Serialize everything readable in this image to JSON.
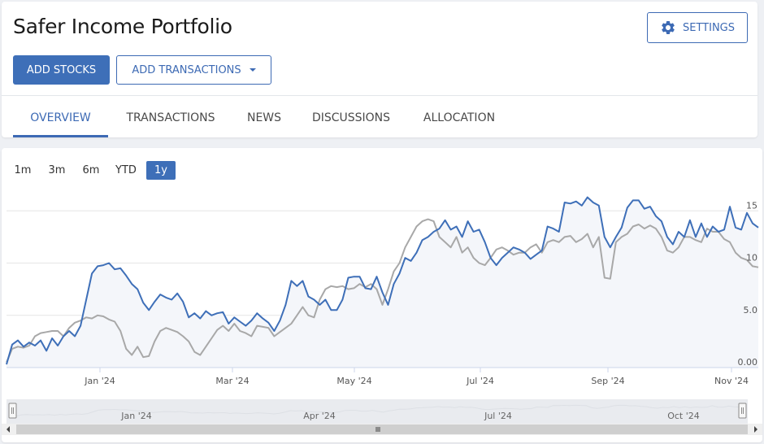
{
  "header": {
    "title": "Safer Income Portfolio",
    "settings_label": "SETTINGS",
    "add_stocks_label": "ADD STOCKS",
    "add_transactions_label": "ADD TRANSACTIONS"
  },
  "tabs": [
    {
      "label": "OVERVIEW",
      "active": true
    },
    {
      "label": "TRANSACTIONS",
      "active": false
    },
    {
      "label": "NEWS",
      "active": false
    },
    {
      "label": "DISCUSSIONS",
      "active": false
    },
    {
      "label": "ALLOCATION",
      "active": false
    }
  ],
  "ranges": [
    {
      "label": "1m",
      "active": false
    },
    {
      "label": "3m",
      "active": false
    },
    {
      "label": "6m",
      "active": false
    },
    {
      "label": "YTD",
      "active": false
    },
    {
      "label": "1y",
      "active": true
    }
  ],
  "colors": {
    "accent": "#3e6fb8",
    "portfolio_line": "#3e6fb8",
    "benchmark_line": "#a8a8a8",
    "area_fill": "#f4f6fa"
  },
  "chart_data": {
    "type": "line",
    "x_ticks": [
      "Jan '24",
      "Mar '24",
      "May '24",
      "Jul '24",
      "Sep '24",
      "Nov '24"
    ],
    "y_ticks": [
      "0.00",
      "5.0",
      "10",
      "15"
    ],
    "ylim": [
      0,
      16.5
    ],
    "grid": true,
    "navigator_labels": [
      "Jan '24",
      "Apr '24",
      "Jul '24",
      "Oct '24"
    ],
    "series": [
      {
        "color": "#3e6fb8",
        "values": [
          0.3,
          2.2,
          2.6,
          2.0,
          2.4,
          2.1,
          2.6,
          1.6,
          2.8,
          2.1,
          3.0,
          3.5,
          3.0,
          4.0,
          6.5,
          9.0,
          9.7,
          9.8,
          10.0,
          9.4,
          9.5,
          8.8,
          8.0,
          7.5,
          6.2,
          5.5,
          6.3,
          7.0,
          6.7,
          6.5,
          7.1,
          6.3,
          4.8,
          5.2,
          4.7,
          5.4,
          5.0,
          5.2,
          5.3,
          4.2,
          4.8,
          4.4,
          4.0,
          4.5,
          5.2,
          4.7,
          4.3,
          3.5,
          4.5,
          6.0,
          8.3,
          7.8,
          8.3,
          6.8,
          6.5,
          6.0,
          6.5,
          5.5,
          5.5,
          6.5,
          8.6,
          8.7,
          8.7,
          7.6,
          7.5,
          8.7,
          7.2,
          6.0,
          8.0,
          9.0,
          10.5,
          10.2,
          11.0,
          12.2,
          12.5,
          13.0,
          13.3,
          14.1,
          13.2,
          13.5,
          12.5,
          14.0,
          13.0,
          13.2,
          12.0,
          10.5,
          9.8,
          10.5,
          11.0,
          11.5,
          11.3,
          11.0,
          10.4,
          10.8,
          11.2,
          13.5,
          13.3,
          13.0,
          15.8,
          15.7,
          15.9,
          15.5,
          16.3,
          15.8,
          15.5,
          12.5,
          11.5,
          12.5,
          13.4,
          15.3,
          16.0,
          16.0,
          15.2,
          15.4,
          14.5,
          14.0,
          12.5,
          11.8,
          13.0,
          12.5,
          14.1,
          12.5,
          13.8,
          12.5,
          13.5,
          13.0,
          13.2,
          15.4,
          13.4,
          13.2,
          14.8,
          13.8,
          13.4
        ]
      },
      {
        "color": "#a8a8a8",
        "values": [
          0.5,
          1.8,
          2.0,
          1.9,
          2.1,
          3.0,
          3.3,
          3.4,
          3.5,
          3.5,
          3.0,
          3.8,
          4.3,
          4.5,
          4.8,
          4.7,
          5.0,
          4.9,
          4.6,
          4.4,
          3.5,
          1.8,
          1.2,
          2.0,
          1.0,
          1.1,
          2.5,
          3.5,
          3.8,
          3.6,
          3.4,
          3.0,
          2.5,
          1.5,
          1.2,
          2.0,
          2.8,
          3.6,
          4.0,
          3.5,
          4.2,
          3.5,
          3.3,
          3.0,
          4.0,
          3.9,
          3.8,
          3.0,
          3.4,
          3.8,
          4.2,
          5.0,
          5.8,
          5.0,
          4.8,
          6.5,
          7.5,
          7.8,
          7.7,
          7.8,
          7.5,
          7.6,
          8.0,
          7.7,
          8.0,
          7.5,
          6.0,
          7.5,
          9.2,
          10.0,
          11.5,
          12.5,
          13.5,
          14.0,
          14.2,
          14.0,
          12.5,
          12.0,
          11.5,
          12.5,
          11.0,
          11.5,
          10.5,
          10.0,
          9.8,
          10.5,
          11.3,
          11.5,
          11.2,
          10.8,
          11.0,
          11.0,
          11.5,
          11.8,
          11.0,
          12.0,
          12.2,
          12.0,
          12.5,
          12.6,
          12.0,
          12.3,
          12.8,
          11.5,
          12.5,
          8.6,
          8.5,
          12.0,
          12.5,
          12.8,
          13.5,
          13.7,
          13.3,
          13.6,
          13.3,
          12.5,
          11.2,
          11.0,
          11.5,
          12.5,
          12.5,
          12.2,
          12.0,
          13.3,
          13.0,
          13.0,
          12.3,
          12.0,
          11.0,
          10.5,
          10.3,
          9.7,
          9.6
        ]
      }
    ]
  }
}
